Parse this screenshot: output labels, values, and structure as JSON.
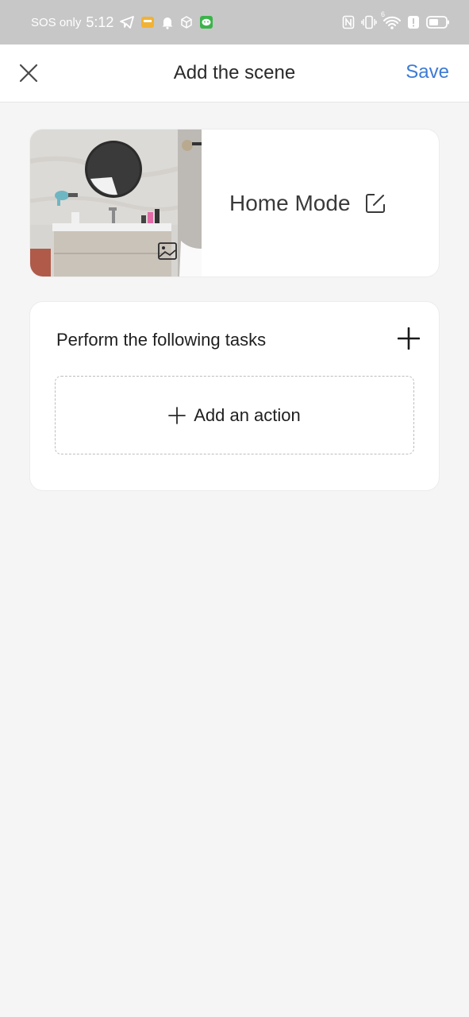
{
  "status_bar": {
    "carrier": "SOS only",
    "time": "5:12",
    "left_icons": [
      "telegram-icon",
      "wallet-app-icon",
      "bell-icon",
      "cube-icon",
      "wechat-icon"
    ],
    "right_icons": [
      "nfc-icon",
      "vibrate-icon",
      "wifi-icon",
      "alert-icon",
      "battery-icon"
    ],
    "wifi_generation": "6"
  },
  "header": {
    "title": "Add the scene",
    "save_label": "Save",
    "close_icon": "close-icon"
  },
  "scene": {
    "name": "Home Mode",
    "image_icon": "image-icon",
    "edit_icon": "edit-icon"
  },
  "tasks": {
    "title": "Perform the following tasks",
    "add_icon": "plus-icon",
    "add_action_label": "Add an action"
  },
  "colors": {
    "accent": "#3d7bd6",
    "background": "#f5f5f5",
    "status_bar": "#c7c7c7"
  }
}
